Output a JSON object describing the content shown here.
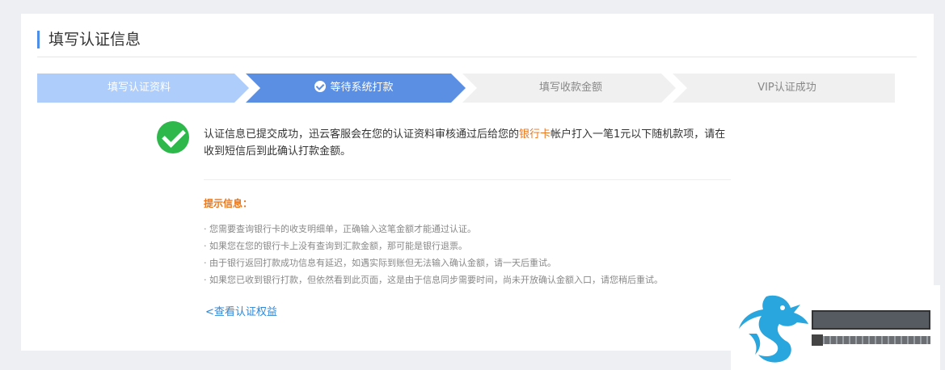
{
  "page": {
    "title": "填写认证信息"
  },
  "steps": [
    {
      "label": "填写认证资料",
      "state": "done"
    },
    {
      "label": "等待系统打款",
      "state": "active"
    },
    {
      "label": "填写收款金额",
      "state": "pending"
    },
    {
      "label": "VIP认证成功",
      "state": "pending"
    }
  ],
  "colors": {
    "done": "#aecdfb",
    "active": "#5b8fe3",
    "pending": "#f0f0f0",
    "success": "#2eb84c",
    "highlight": "#e8771e",
    "link": "#2f86d6"
  },
  "message": {
    "before": "认证信息已提交成功，迅云客服会在您的认证资料审核通过后给您的",
    "highlight": "银行卡",
    "after": "帐户打入一笔1元以下随机款项，请在收到短信后到此确认打款金额。"
  },
  "hints": {
    "title": "提示信息：",
    "items": [
      "· 您需要查询银行卡的收支明细单，正确输入这笔金额才能通过认证。",
      "· 如果您在您的银行卡上没有查询到汇款金额，那可能是银行退票。",
      "· 由于银行返回打款成功信息有延迟，如遇实际到账但无法输入确认金额，请一天后重试。",
      "· 如果您已收到银行打款，但依然看到此页面，这是由于信息同步需要时间，尚未开放确认金额入口，请您稍后重试。"
    ]
  },
  "link": {
    "label": "<查看认证权益"
  },
  "icons": {
    "success": "check-circle-icon",
    "step_check": "check-icon",
    "watermark": "dragon-logo-icon"
  }
}
